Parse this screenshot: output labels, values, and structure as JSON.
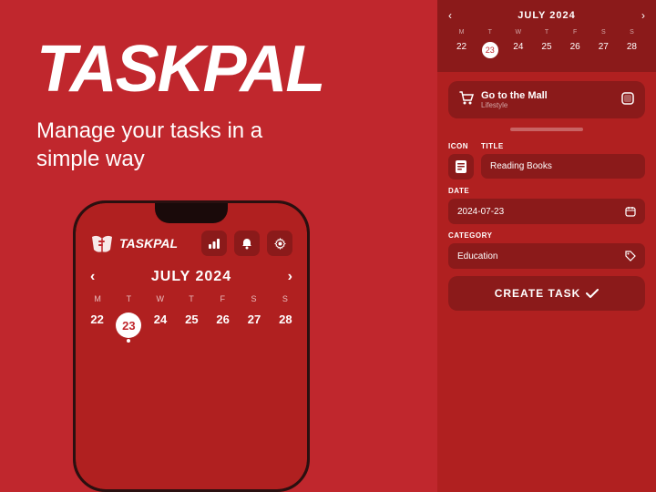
{
  "app": {
    "title": "TASKPAL",
    "subtitle": "Manage your tasks in a simple way"
  },
  "left_phone": {
    "header": {
      "logo": "TASKPAL"
    },
    "calendar": {
      "month": "JULY 2024",
      "days": [
        "M",
        "T",
        "W",
        "T",
        "F",
        "S",
        "S"
      ],
      "dates": [
        "22",
        "23",
        "24",
        "25",
        "26",
        "27",
        "28"
      ]
    }
  },
  "right_phone": {
    "calendar": {
      "month": "JULY 2024",
      "days": [
        "M",
        "T",
        "W",
        "T",
        "F",
        "S",
        "S"
      ],
      "dates": [
        "22",
        "23",
        "24",
        "25",
        "26",
        "27",
        "28"
      ]
    },
    "task": {
      "title": "Go to the Mall",
      "subtitle": "Lifestyle"
    },
    "form": {
      "icon_label": "ICON",
      "icon_value": "📖",
      "title_label": "TITLE",
      "title_value": "Reading Books",
      "date_label": "DATE",
      "date_value": "2024-07-23",
      "category_label": "CATEGORY",
      "category_value": "Education",
      "create_button": "CREATE TASK"
    }
  },
  "icons": {
    "chart": "📊",
    "bell": "🔔",
    "gear": "⚙",
    "cart": "🛒",
    "book": "📖",
    "calendar": "📅",
    "tag": "🏷",
    "check": "✓",
    "arrow_left": "‹",
    "arrow_right": "›"
  },
  "colors": {
    "bg": "#c0272d",
    "dark_red": "#8b1a1a",
    "white": "#ffffff"
  }
}
